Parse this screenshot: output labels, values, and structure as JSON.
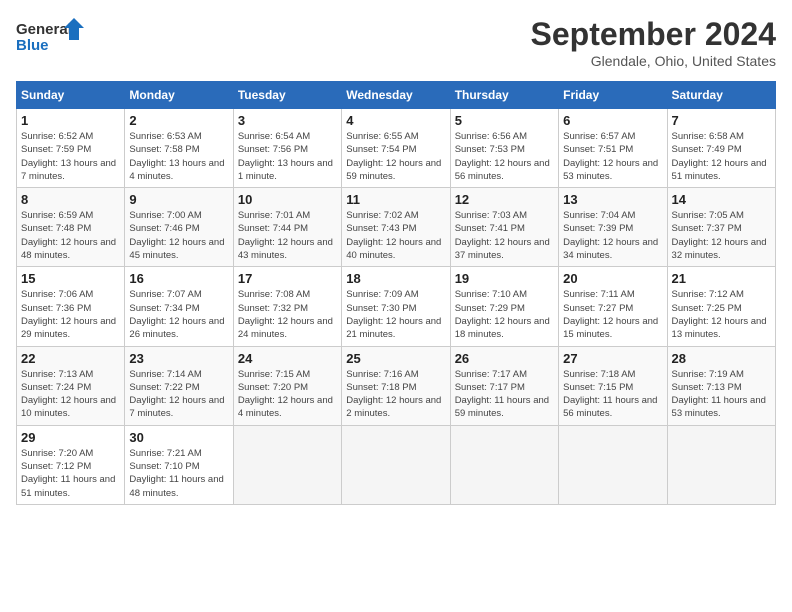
{
  "header": {
    "logo_line1": "General",
    "logo_line2": "Blue",
    "title": "September 2024",
    "subtitle": "Glendale, Ohio, United States"
  },
  "calendar": {
    "headers": [
      "Sunday",
      "Monday",
      "Tuesday",
      "Wednesday",
      "Thursday",
      "Friday",
      "Saturday"
    ],
    "weeks": [
      [
        {
          "day": "1",
          "content": "Sunrise: 6:52 AM\nSunset: 7:59 PM\nDaylight: 13 hours and 7 minutes."
        },
        {
          "day": "2",
          "content": "Sunrise: 6:53 AM\nSunset: 7:58 PM\nDaylight: 13 hours and 4 minutes."
        },
        {
          "day": "3",
          "content": "Sunrise: 6:54 AM\nSunset: 7:56 PM\nDaylight: 13 hours and 1 minute."
        },
        {
          "day": "4",
          "content": "Sunrise: 6:55 AM\nSunset: 7:54 PM\nDaylight: 12 hours and 59 minutes."
        },
        {
          "day": "5",
          "content": "Sunrise: 6:56 AM\nSunset: 7:53 PM\nDaylight: 12 hours and 56 minutes."
        },
        {
          "day": "6",
          "content": "Sunrise: 6:57 AM\nSunset: 7:51 PM\nDaylight: 12 hours and 53 minutes."
        },
        {
          "day": "7",
          "content": "Sunrise: 6:58 AM\nSunset: 7:49 PM\nDaylight: 12 hours and 51 minutes."
        }
      ],
      [
        {
          "day": "8",
          "content": "Sunrise: 6:59 AM\nSunset: 7:48 PM\nDaylight: 12 hours and 48 minutes."
        },
        {
          "day": "9",
          "content": "Sunrise: 7:00 AM\nSunset: 7:46 PM\nDaylight: 12 hours and 45 minutes."
        },
        {
          "day": "10",
          "content": "Sunrise: 7:01 AM\nSunset: 7:44 PM\nDaylight: 12 hours and 43 minutes."
        },
        {
          "day": "11",
          "content": "Sunrise: 7:02 AM\nSunset: 7:43 PM\nDaylight: 12 hours and 40 minutes."
        },
        {
          "day": "12",
          "content": "Sunrise: 7:03 AM\nSunset: 7:41 PM\nDaylight: 12 hours and 37 minutes."
        },
        {
          "day": "13",
          "content": "Sunrise: 7:04 AM\nSunset: 7:39 PM\nDaylight: 12 hours and 34 minutes."
        },
        {
          "day": "14",
          "content": "Sunrise: 7:05 AM\nSunset: 7:37 PM\nDaylight: 12 hours and 32 minutes."
        }
      ],
      [
        {
          "day": "15",
          "content": "Sunrise: 7:06 AM\nSunset: 7:36 PM\nDaylight: 12 hours and 29 minutes."
        },
        {
          "day": "16",
          "content": "Sunrise: 7:07 AM\nSunset: 7:34 PM\nDaylight: 12 hours and 26 minutes."
        },
        {
          "day": "17",
          "content": "Sunrise: 7:08 AM\nSunset: 7:32 PM\nDaylight: 12 hours and 24 minutes."
        },
        {
          "day": "18",
          "content": "Sunrise: 7:09 AM\nSunset: 7:30 PM\nDaylight: 12 hours and 21 minutes."
        },
        {
          "day": "19",
          "content": "Sunrise: 7:10 AM\nSunset: 7:29 PM\nDaylight: 12 hours and 18 minutes."
        },
        {
          "day": "20",
          "content": "Sunrise: 7:11 AM\nSunset: 7:27 PM\nDaylight: 12 hours and 15 minutes."
        },
        {
          "day": "21",
          "content": "Sunrise: 7:12 AM\nSunset: 7:25 PM\nDaylight: 12 hours and 13 minutes."
        }
      ],
      [
        {
          "day": "22",
          "content": "Sunrise: 7:13 AM\nSunset: 7:24 PM\nDaylight: 12 hours and 10 minutes."
        },
        {
          "day": "23",
          "content": "Sunrise: 7:14 AM\nSunset: 7:22 PM\nDaylight: 12 hours and 7 minutes."
        },
        {
          "day": "24",
          "content": "Sunrise: 7:15 AM\nSunset: 7:20 PM\nDaylight: 12 hours and 4 minutes."
        },
        {
          "day": "25",
          "content": "Sunrise: 7:16 AM\nSunset: 7:18 PM\nDaylight: 12 hours and 2 minutes."
        },
        {
          "day": "26",
          "content": "Sunrise: 7:17 AM\nSunset: 7:17 PM\nDaylight: 11 hours and 59 minutes."
        },
        {
          "day": "27",
          "content": "Sunrise: 7:18 AM\nSunset: 7:15 PM\nDaylight: 11 hours and 56 minutes."
        },
        {
          "day": "28",
          "content": "Sunrise: 7:19 AM\nSunset: 7:13 PM\nDaylight: 11 hours and 53 minutes."
        }
      ],
      [
        {
          "day": "29",
          "content": "Sunrise: 7:20 AM\nSunset: 7:12 PM\nDaylight: 11 hours and 51 minutes."
        },
        {
          "day": "30",
          "content": "Sunrise: 7:21 AM\nSunset: 7:10 PM\nDaylight: 11 hours and 48 minutes."
        },
        {
          "day": "",
          "content": ""
        },
        {
          "day": "",
          "content": ""
        },
        {
          "day": "",
          "content": ""
        },
        {
          "day": "",
          "content": ""
        },
        {
          "day": "",
          "content": ""
        }
      ]
    ]
  }
}
